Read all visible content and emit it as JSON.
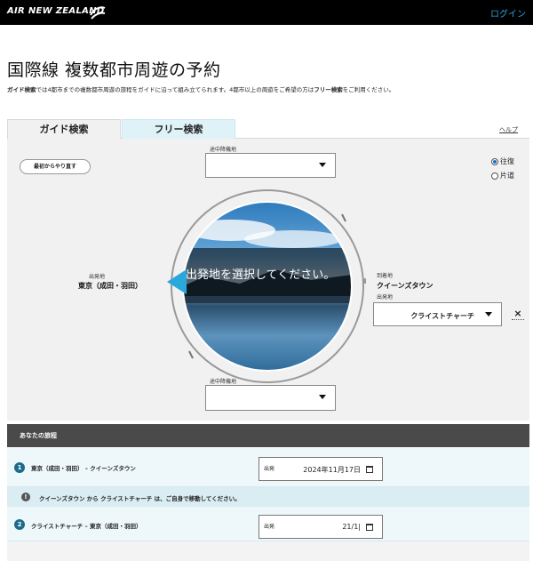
{
  "header": {
    "brand": "AIR NEW ZEALAND",
    "login": "ログイン"
  },
  "page": {
    "title": "国際線 複数都市周遊の予約",
    "intro_bold1": "ガイド検索",
    "intro_mid": "では4都市までの複数都市周遊の旅程をガイドに沿って組み立てられます。4都市以上の周遊をご希望の方は",
    "intro_bold2": "フリー検索",
    "intro_end": "をご利用ください。"
  },
  "tabs": {
    "guide": "ガイド検索",
    "free": "フリー検索"
  },
  "help": "ヘルプ",
  "restart": "最初からやり直す",
  "trip_type": {
    "round": "往復",
    "oneway": "片道",
    "selected": "round"
  },
  "stopover_top": {
    "label": "途中降機地",
    "value": ""
  },
  "stopover_bottom": {
    "label": "途中降機地",
    "value": ""
  },
  "origin": {
    "label": "出発地",
    "value": "東京（成田・羽田）"
  },
  "destination": {
    "label": "到着地",
    "value": "クイーンズタウン"
  },
  "depart_from": {
    "label": "出発地",
    "value": "クライストチャーチ"
  },
  "overlay_text": "出発地を選択してください。",
  "itinerary": {
    "heading": "あなたの旅程",
    "legs": [
      {
        "num": "1",
        "route": "東京（成田・羽田） – クイーンズタウン",
        "date_label": "出発",
        "date": "2024年11月17日"
      },
      {
        "num": "2",
        "route": "クライストチャーチ – 東京（成田・羽田）",
        "date_label": "出発",
        "date": "21/1|"
      }
    ],
    "notice": "クイーンズタウン から クライストチャーチ は、ご自身で移動してください。"
  },
  "colors": {
    "accent": "#26a8d8",
    "header_bg": "#000000",
    "itin_head_bg": "#4a4a4a"
  }
}
